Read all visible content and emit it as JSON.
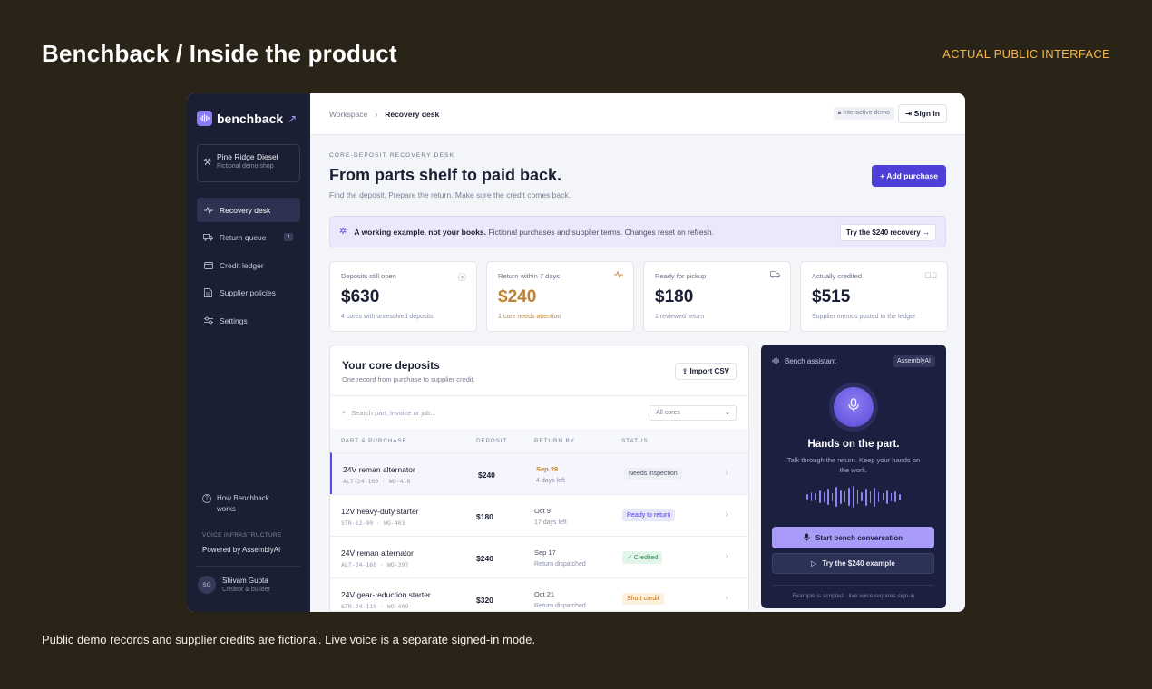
{
  "slide": {
    "title": "Benchback / Inside the product",
    "tag": "ACTUAL PUBLIC INTERFACE",
    "footer": "Public demo records and supplier credits are fictional. Live voice is a separate signed-in mode."
  },
  "brand": {
    "name": "benchback",
    "accent": "#8b7cf6",
    "primary": "#4d3fd8"
  },
  "sidebar": {
    "shop_name": "Pine Ridge Diesel",
    "shop_sub": "Fictional demo shop",
    "items": [
      {
        "label": "Recovery desk",
        "icon": "pulse-icon",
        "active": true
      },
      {
        "label": "Return queue",
        "icon": "truck-icon",
        "badge": "1"
      },
      {
        "label": "Credit ledger",
        "icon": "wallet-icon"
      },
      {
        "label": "Supplier policies",
        "icon": "document-icon"
      },
      {
        "label": "Settings",
        "icon": "sliders-icon"
      }
    ],
    "how_label": "How Benchback works",
    "voice_infra": "VOICE INFRASTRUCTURE",
    "powered": "Powered by AssemblyAI",
    "user": {
      "initials": "SG",
      "name": "Shivam Gupta",
      "role": "Creator & builder"
    }
  },
  "topbar": {
    "crumb_root": "Workspace",
    "crumb_sep": "›",
    "crumb_current": "Recovery desk",
    "demo_badge": "Interactive demo",
    "signin": "Sign in"
  },
  "header": {
    "kicker": "CORE-DEPOSIT RECOVERY DESK",
    "title": "From parts shelf to paid back.",
    "subtitle": "Find the deposit. Prepare the return. Make sure the credit comes back.",
    "add_button": "Add purchase"
  },
  "banner": {
    "bold": "A working example, not your books.",
    "text": "Fictional purchases and supplier terms. Changes reset on refresh.",
    "button": "Try the $240 recovery"
  },
  "stats": [
    {
      "label": "Deposits still open",
      "value": "$630",
      "note": "4 cores with unresolved deposits",
      "icon": "dollar-icon"
    },
    {
      "label": "Return within 7 days",
      "value": "$240",
      "note": "1 core needs attention",
      "icon": "pulse-icon"
    },
    {
      "label": "Ready for pickup",
      "value": "$180",
      "note": "1 reviewed return",
      "icon": "truck-icon"
    },
    {
      "label": "Actually credited",
      "value": "$515",
      "note": "Supplier memos posted to the ledger",
      "icon": "check-circle-icon"
    }
  ],
  "deposits": {
    "title": "Your core deposits",
    "subtitle": "One record from purchase to supplier credit.",
    "import_button": "Import CSV",
    "search_placeholder": "Search part, invoice or job...",
    "filter_value": "All cores",
    "columns": [
      "PART & PURCHASE",
      "DEPOSIT",
      "RETURN BY",
      "STATUS"
    ],
    "rows": [
      {
        "part": "24V reman alternator",
        "ref": "ALT-24-160 · WO-418",
        "amount": "$240",
        "date": "Sep 28",
        "sub": "4 days left",
        "status": "Needs inspection"
      },
      {
        "part": "12V heavy-duty starter",
        "ref": "STR-12-90 · WO-403",
        "amount": "$180",
        "date": "Oct 9",
        "sub": "17 days left",
        "status": "Ready to return"
      },
      {
        "part": "24V reman alternator",
        "ref": "ALT-24-160 · WO-397",
        "amount": "$240",
        "date": "Sep 17",
        "sub": "Return dispatched",
        "status": "✓ Credited"
      },
      {
        "part": "24V gear-reduction starter",
        "ref": "STR-24-110 · WO-409",
        "amount": "$320",
        "date": "Oct 21",
        "sub": "Return dispatched",
        "status": "Short credit"
      }
    ]
  },
  "assistant": {
    "title": "Bench assistant",
    "badge": "AssemblyAI",
    "heading": "Hands on the part.",
    "text": "Talk through the return. Keep your hands on the work.",
    "primary_button": "Start bench conversation",
    "secondary_button": "Try the $240 example",
    "footnote": "Example is scripted · live voice requires sign-in"
  }
}
